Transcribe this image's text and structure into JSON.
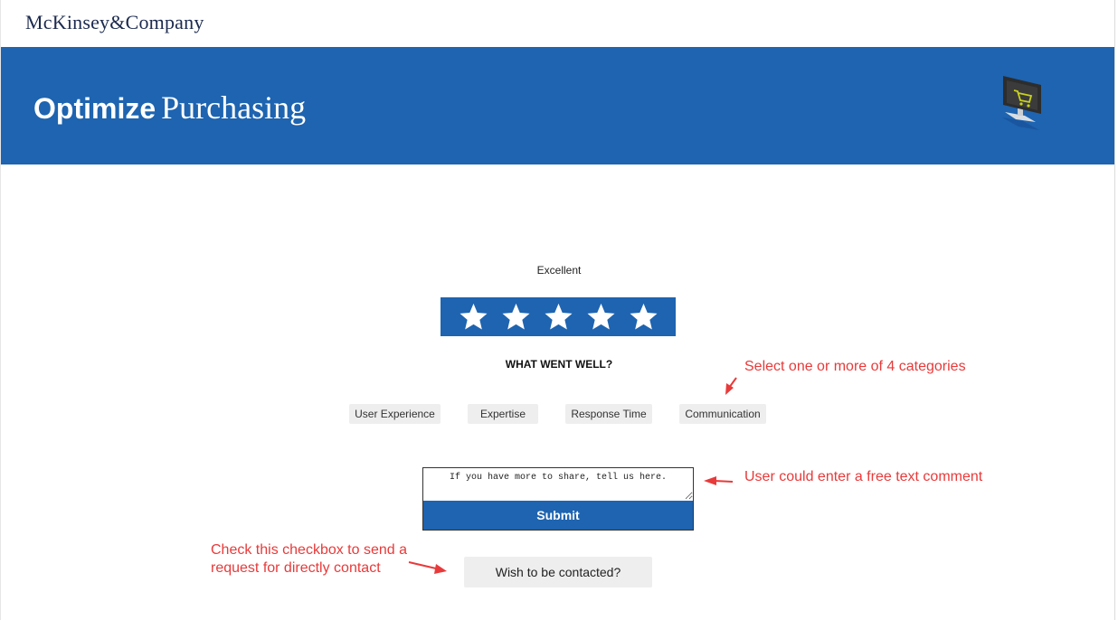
{
  "header": {
    "brand": "McKinsey&Company"
  },
  "banner": {
    "title_bold": "Optimize",
    "title_serif": "Purchasing",
    "icon": "computer-shopping-cart-icon",
    "color": "#1e64b0"
  },
  "rating": {
    "label": "Excellent",
    "value": 5,
    "max": 5
  },
  "feedback": {
    "heading": "WHAT WENT WELL?",
    "categories": [
      "User Experience",
      "Expertise",
      "Response Time",
      "Communication"
    ]
  },
  "comment": {
    "placeholder": "If you have more to share, tell us here.",
    "submit_label": "Submit"
  },
  "contact": {
    "label": "Wish to be contacted?"
  },
  "annotations": {
    "categories_note": "Select one or more of 4 categories",
    "comment_note": "User could enter a free text comment",
    "contact_note_line1": "Check this checkbox to send a",
    "contact_note_line2": "request for directly contact",
    "color": "#e83a3a"
  }
}
